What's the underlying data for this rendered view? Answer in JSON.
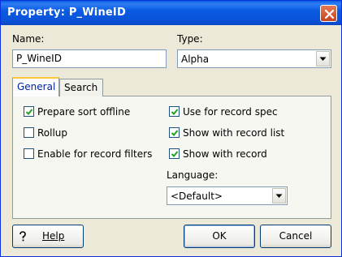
{
  "window": {
    "title": "Property:  P_WineID"
  },
  "name_field": {
    "label": "Name:",
    "value": "P_WineID"
  },
  "type_field": {
    "label": "Type:",
    "value": "Alpha"
  },
  "tabs": [
    {
      "label": "General",
      "active": true
    },
    {
      "label": "Search",
      "active": false
    }
  ],
  "checkboxes_left": [
    {
      "label": "Prepare sort offline",
      "checked": true
    },
    {
      "label": "Rollup",
      "checked": false
    },
    {
      "label": "Enable for record filters",
      "checked": false
    }
  ],
  "checkboxes_right": [
    {
      "label": "Use for record spec",
      "checked": true
    },
    {
      "label": "Show with record list",
      "checked": true
    },
    {
      "label": "Show with record",
      "checked": true
    }
  ],
  "language": {
    "label": "Language:",
    "value": "<Default>"
  },
  "buttons": {
    "help": "Help",
    "ok": "OK",
    "cancel": "Cancel"
  },
  "icons": {
    "close": "close-icon",
    "help": "help-icon",
    "dropdown": "chevron-down-icon",
    "check": "checkmark-icon"
  }
}
